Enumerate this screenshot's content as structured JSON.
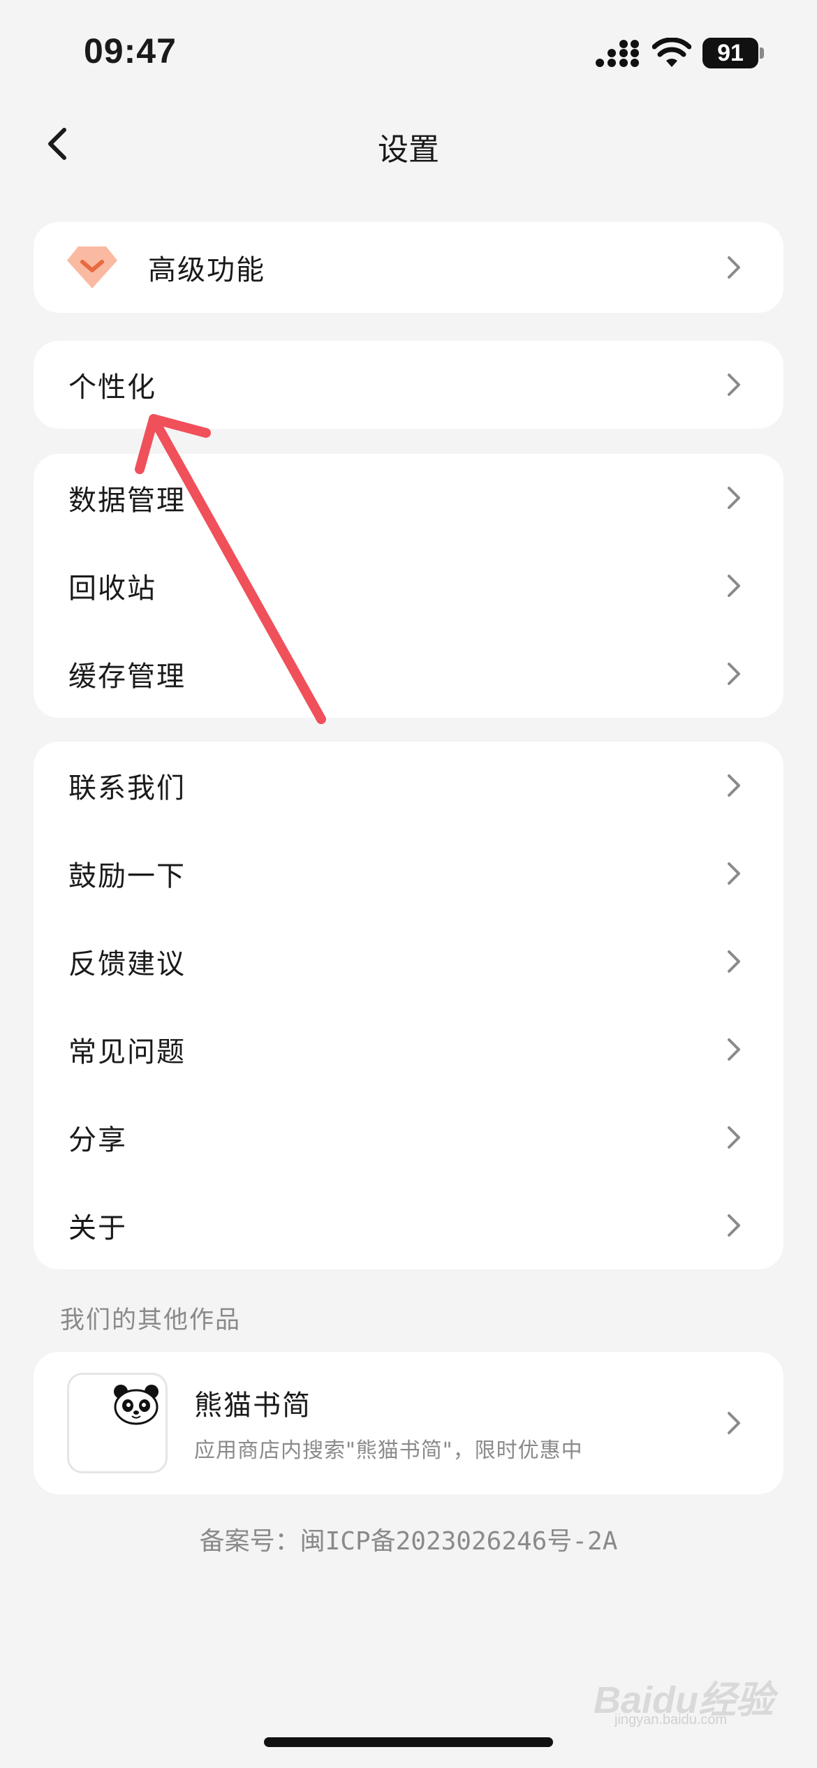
{
  "status_bar": {
    "time": "09:47",
    "battery": "91"
  },
  "nav": {
    "title": "设置"
  },
  "premium": {
    "label": "高级功能"
  },
  "personalize": {
    "label": "个性化"
  },
  "data_group": {
    "items": [
      {
        "label": "数据管理"
      },
      {
        "label": "回收站"
      },
      {
        "label": "缓存管理"
      }
    ]
  },
  "support_group": {
    "items": [
      {
        "label": "联系我们"
      },
      {
        "label": "鼓励一下"
      },
      {
        "label": "反馈建议"
      },
      {
        "label": "常见问题"
      },
      {
        "label": "分享"
      },
      {
        "label": "关于"
      }
    ]
  },
  "other_works": {
    "caption": "我们的其他作品",
    "product": {
      "name": "熊猫书简",
      "desc": "应用商店内搜索\"熊猫书简\"，限时优惠中"
    }
  },
  "footer": {
    "icp": "备案号：闽ICP备2023026246号-2A"
  },
  "watermark": {
    "text": "Baidu经验",
    "sub": "jingyan.baidu.com"
  },
  "colors": {
    "annotation_arrow": "#f0505a",
    "premium_icon": "#f7a17f",
    "background": "#f4f4f4"
  }
}
